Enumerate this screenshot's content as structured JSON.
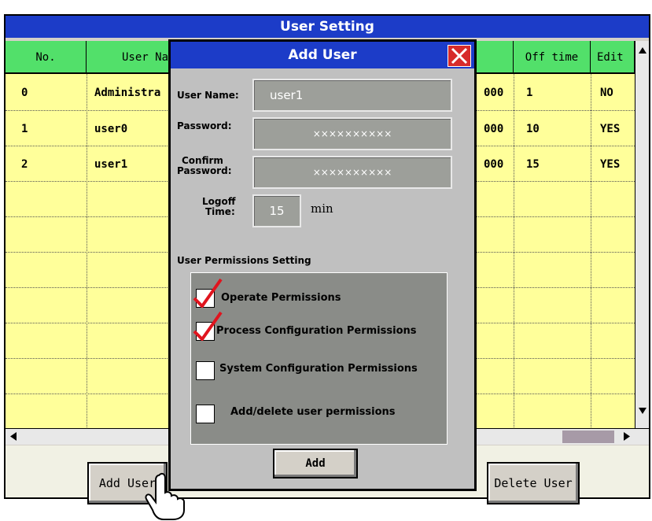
{
  "window": {
    "title": "User Setting"
  },
  "table": {
    "columns": [
      "No.",
      "User Na",
      "Off time",
      "Edit"
    ],
    "rows": [
      {
        "no": "0",
        "name": "Administra",
        "code": "000",
        "off": "1",
        "edit": "NO"
      },
      {
        "no": "1",
        "name": "user0",
        "code": "000",
        "off": "10",
        "edit": "YES"
      },
      {
        "no": "2",
        "name": "user1",
        "code": "000",
        "off": "15",
        "edit": "YES"
      }
    ]
  },
  "footer": {
    "add_user": "Add User",
    "delete_user": "Delete User"
  },
  "dialog": {
    "title": "Add User",
    "user_name_label": "User Name:",
    "user_name_value": "user1",
    "password_label": "Password:",
    "password_value": "××××××××××",
    "confirm_label_1": "Confirm",
    "confirm_label_2": "Password:",
    "confirm_value": "××××××××××",
    "logoff_label_1": "Logoff",
    "logoff_label_2": "Time:",
    "logoff_value": "15",
    "logoff_unit": "min",
    "permissions_title": "User Permissions Setting",
    "permissions": [
      {
        "label": "Operate Permissions",
        "checked": true
      },
      {
        "label": "Process Configuration Permissions",
        "checked": true
      },
      {
        "label": "System Configuration Permissions",
        "checked": false
      },
      {
        "label": "Add/delete user permissions",
        "checked": false
      }
    ],
    "add_button": "Add"
  },
  "colors": {
    "title_blue": "#1c3cc8",
    "header_green": "#52e06a",
    "grid_yellow": "#ffff9a",
    "close_red": "#d72b2b",
    "check_red": "#e0141e"
  }
}
